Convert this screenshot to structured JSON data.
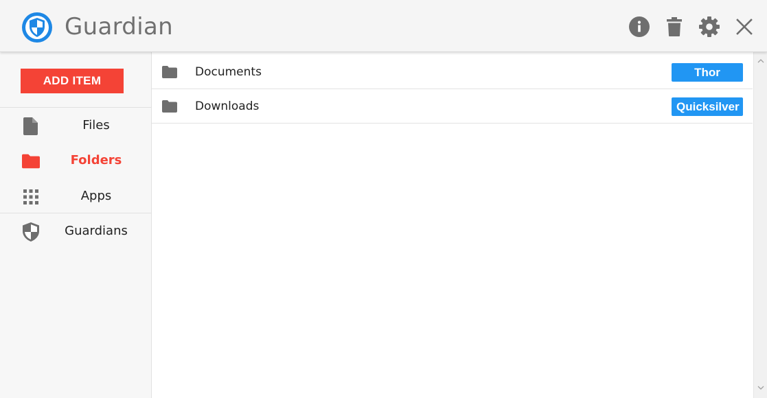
{
  "header": {
    "title": "Guardian",
    "logo_icon": "shield-logo-icon",
    "actions": [
      {
        "name": "info-icon"
      },
      {
        "name": "trash-icon"
      },
      {
        "name": "gear-icon"
      },
      {
        "name": "close-icon"
      }
    ]
  },
  "sidebar": {
    "add_button_label": "ADD ITEM",
    "items": [
      {
        "label": "Files",
        "icon": "file-icon",
        "active": false
      },
      {
        "label": "Folders",
        "icon": "folder-icon",
        "active": true
      },
      {
        "label": "Apps",
        "icon": "apps-grid-icon",
        "active": false
      },
      {
        "label": "Guardians",
        "icon": "shield-icon",
        "active": false
      }
    ]
  },
  "list": {
    "rows": [
      {
        "name": "Documents",
        "guardian": "Thor"
      },
      {
        "name": "Downloads",
        "guardian": "Quicksilver"
      }
    ]
  },
  "colors": {
    "accent_red": "#f44336",
    "badge_blue": "#2196f3",
    "icon_gray": "#6e6e6e",
    "logo_blue": "#1e88e5"
  }
}
